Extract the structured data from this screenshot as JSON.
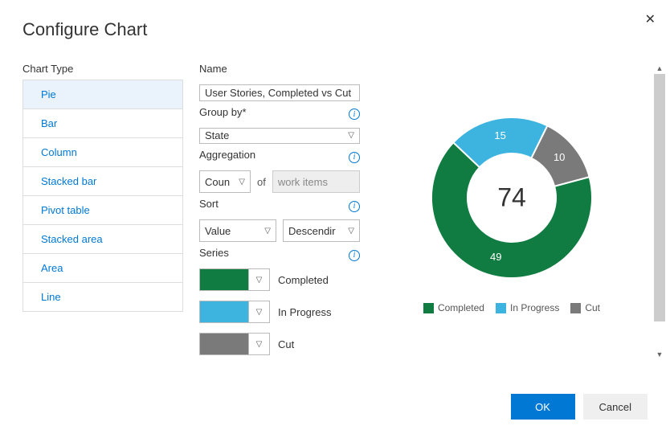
{
  "dialog": {
    "title": "Configure Chart",
    "close": "✕"
  },
  "chartType": {
    "label": "Chart Type",
    "items": [
      {
        "label": "Pie",
        "selected": true
      },
      {
        "label": "Bar",
        "selected": false
      },
      {
        "label": "Column",
        "selected": false
      },
      {
        "label": "Stacked bar",
        "selected": false
      },
      {
        "label": "Pivot table",
        "selected": false
      },
      {
        "label": "Stacked area",
        "selected": false
      },
      {
        "label": "Area",
        "selected": false
      },
      {
        "label": "Line",
        "selected": false
      }
    ]
  },
  "fields": {
    "nameLabel": "Name",
    "nameValue": "User Stories, Completed vs Cut",
    "groupByLabel": "Group by*",
    "groupByValue": "State",
    "aggregationLabel": "Aggregation",
    "aggregationValue": "Coun",
    "ofText": "of",
    "workItemsPlaceholder": "work items",
    "sortLabel": "Sort",
    "sortBy": "Value",
    "sortDir": "Descendir",
    "seriesLabel": "Series"
  },
  "series": [
    {
      "label": "Completed",
      "color": "#107c41"
    },
    {
      "label": "In Progress",
      "color": "#3db3e0"
    },
    {
      "label": "Cut",
      "color": "#7a7a7a"
    }
  ],
  "chart_data": {
    "type": "pie",
    "title": "",
    "total": 74,
    "slices": [
      {
        "name": "Completed",
        "value": 49,
        "color": "#107c41"
      },
      {
        "name": "In Progress",
        "value": 15,
        "color": "#3db3e0"
      },
      {
        "name": "Cut",
        "value": 10,
        "color": "#7a7a7a"
      }
    ]
  },
  "footer": {
    "ok": "OK",
    "cancel": "Cancel"
  }
}
